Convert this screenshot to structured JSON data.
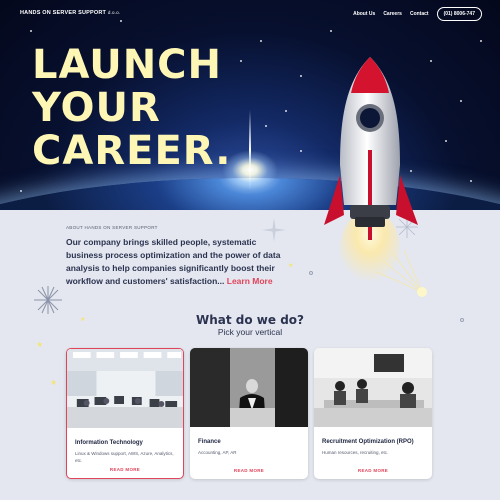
{
  "header": {
    "brand": "HANDS ON SERVER SUPPORT",
    "brand_suffix": "d.o.o.",
    "nav": [
      "About Us",
      "Careers",
      "Contact"
    ],
    "phone": "(01) 8006-747"
  },
  "hero": {
    "line1": "LAUNCH",
    "line2": "YOUR",
    "line3": "CAREER."
  },
  "about": {
    "label": "ABOUT HANDS ON SERVER SUPPORT",
    "text": "Our  company brings skilled people, systematic business process optimization and the power of data analysis to help companies significantly boost their workflow and customers' satisfaction...",
    "link": "Learn More"
  },
  "section": {
    "title": "What do we do?",
    "subtitle": "Pick your vertical"
  },
  "cards": [
    {
      "title": "Information Technology",
      "desc": "Linux & Windows support, AWS, Azure, Analytics, etc.",
      "more": "READ MORE"
    },
    {
      "title": "Finance",
      "desc": "Accounting, AP, AR",
      "more": "READ MORE"
    },
    {
      "title": "Recruitment Optimization (RPO)",
      "desc": "Human resources, recruiting, etc.",
      "more": "READ MORE"
    }
  ],
  "colors": {
    "accent": "#e0445a",
    "headline": "#fdf6b4",
    "text_dark": "#2b3350",
    "page_bg": "#e4e7ef"
  }
}
